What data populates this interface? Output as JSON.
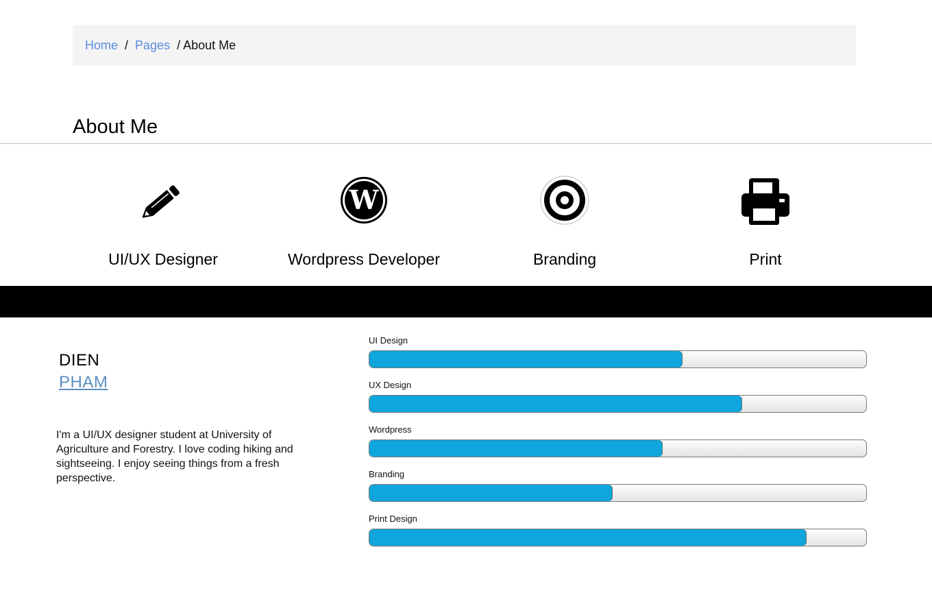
{
  "breadcrumb": {
    "home": "Home",
    "separator": "/",
    "pages": "Pages",
    "current_separator": "/",
    "current": "About Me"
  },
  "page_title": "About Me",
  "services": [
    {
      "label": "UI/UX Designer",
      "icon": "pencil-icon"
    },
    {
      "label": "Wordpress Developer",
      "icon": "wordpress-icon"
    },
    {
      "label": "Branding",
      "icon": "target-icon"
    },
    {
      "label": "Print",
      "icon": "printer-icon"
    }
  ],
  "profile": {
    "first_name": "DIEN",
    "last_name": "PHAM",
    "bio": "I'm a UI/UX designer student at University of Agriculture and Forestry. I love coding hiking and sightseeing. I enjoy seeing things from a fresh perspective."
  },
  "skills": [
    {
      "label": "UI Design",
      "level": 0.63
    },
    {
      "label": "UX Design",
      "level": 0.75
    },
    {
      "label": "Wordpress",
      "level": 0.59
    },
    {
      "label": "Branding",
      "level": 0.49
    },
    {
      "label": "Print Design",
      "level": 0.88
    }
  ],
  "colors": {
    "link": "#5b8de0",
    "progress_fill": "#0ea6dc",
    "band": "#000000"
  }
}
